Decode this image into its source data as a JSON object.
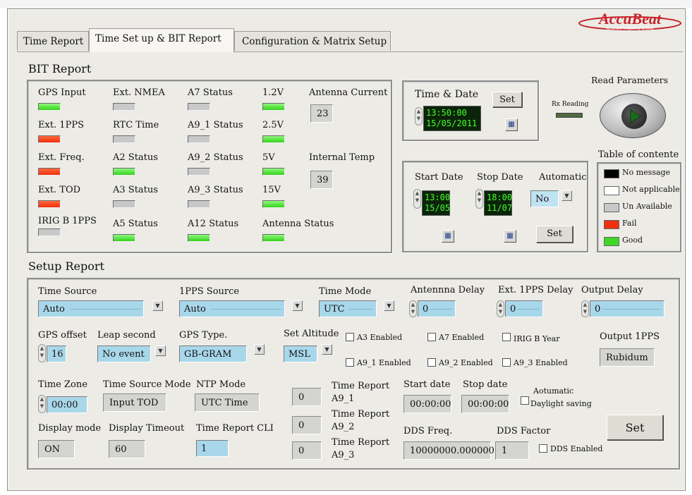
{
  "brand": {
    "name": "AccuBeat",
    "tagline": "Accurate frequency & time"
  },
  "tabs": [
    {
      "label": "Time Report"
    },
    {
      "label": "Time Set up & BIT Report"
    },
    {
      "label": "Configuration & Matrix Setup"
    }
  ],
  "bit": {
    "heading": "BIT Report",
    "items": [
      {
        "label": "GPS Input",
        "state": "green"
      },
      {
        "label": "Ext. 1PPS",
        "state": "red"
      },
      {
        "label": "Ext. Freq.",
        "state": "red"
      },
      {
        "label": "Ext. TOD",
        "state": "red"
      },
      {
        "label": "IRIG B 1PPS",
        "state": "gray"
      },
      {
        "label": "Ext. NMEA",
        "state": "gray"
      },
      {
        "label": "RTC Time",
        "state": "gray"
      },
      {
        "label": "A2 Status",
        "state": "green"
      },
      {
        "label": "A3 Status",
        "state": "gray"
      },
      {
        "label": "A5 Status",
        "state": "green"
      },
      {
        "label": "A7 Status",
        "state": "gray"
      },
      {
        "label": "A9_1 Status",
        "state": "gray"
      },
      {
        "label": "A9_2 Status",
        "state": "gray"
      },
      {
        "label": "A9_3 Status",
        "state": "gray"
      },
      {
        "label": "A12 Status",
        "state": "green"
      },
      {
        "label": "1.2V",
        "state": "green"
      },
      {
        "label": "2.5V",
        "state": "green"
      },
      {
        "label": "5V",
        "state": "green"
      },
      {
        "label": "15V",
        "state": "green"
      },
      {
        "label": "Antenna Status",
        "state": "green"
      }
    ],
    "antenna_current": {
      "label": "Antenna Current",
      "value": "23"
    },
    "internal_temp": {
      "label": "Internal Temp",
      "value": "39"
    }
  },
  "time_date": {
    "label": "Time & Date",
    "set_label": "Set",
    "time": "13:50:00",
    "date": "15/05/2011"
  },
  "rx_reading": {
    "label": "Rx Reading"
  },
  "read_parameters": {
    "label": "Read Parameters"
  },
  "schedule": {
    "start_label": "Start Date",
    "start_time": "13:00",
    "start_date": "15/05",
    "stop_label": "Stop Date",
    "stop_time": "18:00",
    "stop_date": "11/07",
    "automatic_label": "Automatic",
    "automatic_value": "No",
    "set_label": "Set"
  },
  "legend": {
    "title": "Table of contente",
    "items": [
      {
        "label": "No message",
        "color": "#000000"
      },
      {
        "label": "Not applicable",
        "color": "#ffffff"
      },
      {
        "label": "Un Available",
        "color": "#c8c8c8"
      },
      {
        "label": "Fail",
        "color": "#f03010"
      },
      {
        "label": "Good",
        "color": "#40d828"
      }
    ]
  },
  "setup": {
    "heading": "Setup Report",
    "time_source": {
      "label": "Time Source",
      "value": "Auto"
    },
    "pps_source": {
      "label": "1PPS Source",
      "value": "Auto"
    },
    "time_mode": {
      "label": "Time Mode",
      "value": "UTC"
    },
    "antenna_delay": {
      "label": "Antennna Delay",
      "value": "0"
    },
    "ext_pps_delay": {
      "label": "Ext. 1PPS Delay",
      "value": "0"
    },
    "output_delay": {
      "label": "Output Delay",
      "value": "0"
    },
    "gps_offset": {
      "label": "GPS offset",
      "value": "16"
    },
    "leap_second": {
      "label": "Leap second",
      "value": "No event"
    },
    "gps_type": {
      "label": "GPS Type.",
      "value": "GB-GRAM"
    },
    "set_altitude": {
      "label": "Set Altitude",
      "value": "MSL"
    },
    "checks": {
      "a3": "A3 Enabled",
      "a7": "A7 Enabled",
      "irig": "IRIG B Year",
      "a9_1": "A9_1 Enabled",
      "a9_2": "A9_2 Enabled",
      "a9_3": "A9_3 Enabled",
      "dds": "DDS Enabled"
    },
    "output_1pps": {
      "label": "Output 1PPS",
      "value": "Rubidum"
    },
    "time_zone": {
      "label": "Time Zone",
      "value": "00:00"
    },
    "time_source_mode": {
      "label": "Time Source Mode",
      "value": "Input TOD"
    },
    "ntp_mode": {
      "label": "NTP Mode",
      "value": "UTC Time"
    },
    "time_report_a9_1": {
      "label_1": "Time Report",
      "label_2": "A9_1",
      "value": "0"
    },
    "time_report_a9_2": {
      "label_1": "Time Report",
      "label_2": "A9_2",
      "value": "0"
    },
    "time_report_a9_3": {
      "label_1": "Time Report",
      "label_2": "A9_3",
      "value": "0"
    },
    "start_date": {
      "label": "Start date",
      "value": "00:00:00"
    },
    "stop_date": {
      "label": "Stop date",
      "value": "00:00:00"
    },
    "daylight": {
      "label_1": "Aotumatic",
      "label_2": "Daylight saving"
    },
    "display_mode": {
      "label": "Display mode",
      "value": "ON"
    },
    "display_timeout": {
      "label": "Display Timeout",
      "value": "60"
    },
    "time_report_cli": {
      "label": "Time Report CLI",
      "value": "1"
    },
    "dds_freq": {
      "label": "DDS Freq.",
      "value": "10000000.000000"
    },
    "dds_factor": {
      "label": "DDS Factor",
      "value": "1"
    },
    "set_label": "Set"
  }
}
